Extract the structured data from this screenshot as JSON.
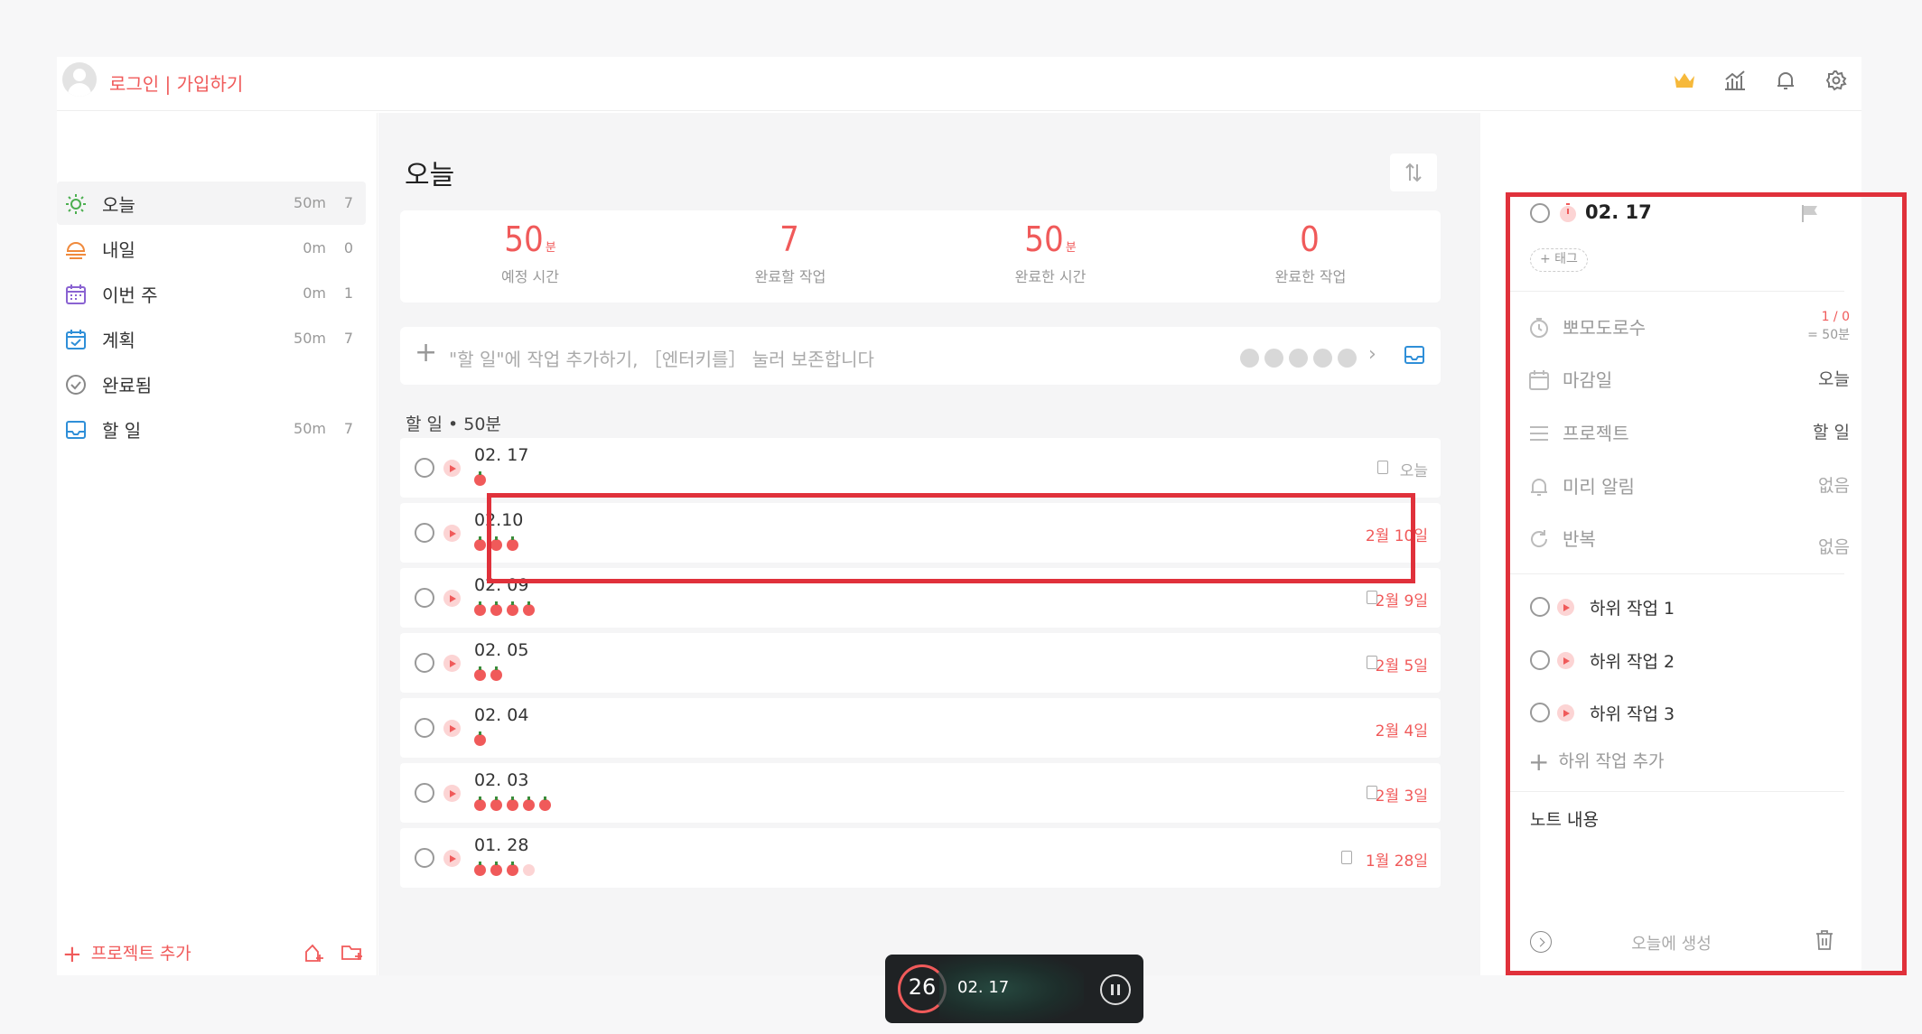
{
  "topbar": {
    "login_label": "로그인 | 가입하기"
  },
  "sidebar": {
    "items": [
      {
        "label": "오늘",
        "time": "50m",
        "count": "7"
      },
      {
        "label": "내일",
        "time": "0m",
        "count": "0"
      },
      {
        "label": "이번 주",
        "time": "0m",
        "count": "1"
      },
      {
        "label": "계획",
        "time": "50m",
        "count": "7"
      },
      {
        "label": "완료됨",
        "time": "",
        "count": ""
      },
      {
        "label": "할 일",
        "time": "50m",
        "count": "7"
      }
    ],
    "add_project": "프로젝트 추가"
  },
  "main": {
    "title": "오늘",
    "stats": [
      {
        "num": "50",
        "unit": "분",
        "label": "예정 시간"
      },
      {
        "num": "7",
        "unit": "",
        "label": "완료할 작업"
      },
      {
        "num": "50",
        "unit": "분",
        "label": "완료한 시간"
      },
      {
        "num": "0",
        "unit": "",
        "label": "완료한 작업"
      }
    ],
    "add_placeholder": "\"할 일\"에 작업 추가하기, ［엔터키를］ 눌러 보존합니다",
    "section_header": "할 일 • 50분",
    "tasks": [
      {
        "title": "02. 17",
        "date": "오늘",
        "pomos_done": 1,
        "pomos_planned": 1
      },
      {
        "title": "02.10",
        "date": "2월 10일",
        "pomos_done": 3,
        "pomos_planned": 3
      },
      {
        "title": "02. 09",
        "date": "2월 9일",
        "pomos_done": 4,
        "pomos_planned": 4
      },
      {
        "title": "02. 05",
        "date": "2월 5일",
        "pomos_done": 2,
        "pomos_planned": 2
      },
      {
        "title": "02. 04",
        "date": "2월 4일",
        "pomos_done": 1,
        "pomos_planned": 1
      },
      {
        "title": "02. 03",
        "date": "2월 3일",
        "pomos_done": 5,
        "pomos_planned": 5
      },
      {
        "title": "01. 28",
        "date": "1월 28일",
        "pomos_done": 3,
        "pomos_planned": 4
      }
    ]
  },
  "timer": {
    "minutes": "26",
    "title": "02. 17"
  },
  "detail": {
    "title": "02. 17",
    "tag_label": "+ 태그",
    "pomodoro_label": "뽀모도로수",
    "pomodoro_value": "1 / 0",
    "pomodoro_sub": "= 50분",
    "deadline_label": "마감일",
    "deadline_value": "오늘",
    "project_label": "프로젝트",
    "project_value": "할 일",
    "reminder_label": "미리 알림",
    "reminder_value": "없음",
    "repeat_label": "반복",
    "repeat_value": "없음",
    "subtasks": [
      "하위 작업 1",
      "하위 작업 2",
      "하위 작업 3"
    ],
    "add_subtask": "하위 작업 추가",
    "note": "노트 내용",
    "created": "오늘에 생성"
  },
  "colors": {
    "accent": "#f05a5a",
    "highlight": "#e0313b"
  }
}
